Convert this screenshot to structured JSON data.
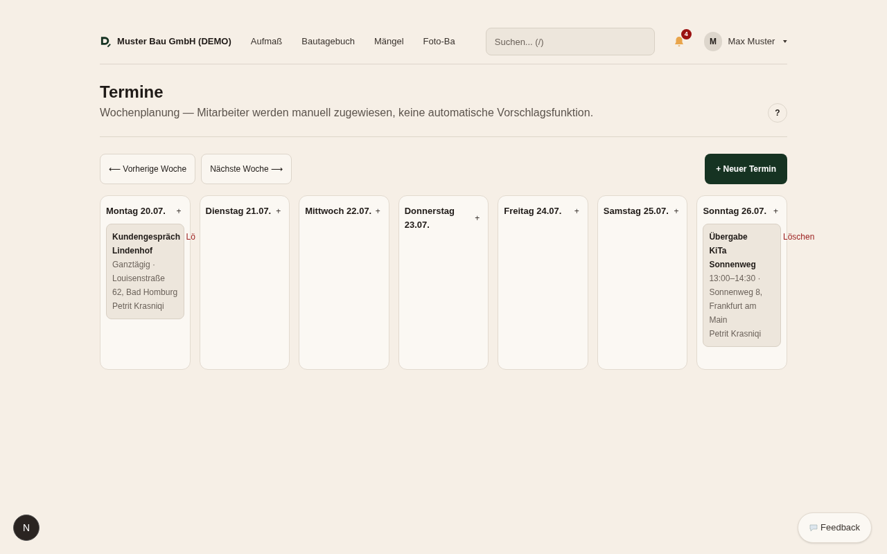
{
  "header": {
    "company": "Muster Bau GmbH (DEMO)",
    "nav": [
      "Aufmaß",
      "Bautagebuch",
      "Mängel",
      "Foto-Ba"
    ],
    "search": {
      "placeholder": "Suchen... (/)"
    },
    "notifications": "4",
    "user": {
      "initial": "M",
      "name": "Max Muster"
    }
  },
  "page": {
    "title": "Termine",
    "subtitle": "Wochenplanung — Mitarbeiter werden manuell zugewiesen, keine automatische Vorschlagsfunktion.",
    "help": "?"
  },
  "toolbar": {
    "prev": "⟵ Vorherige Woche",
    "next": "Nächste Woche ⟶",
    "new": "+ Neuer Termin"
  },
  "days": [
    {
      "label": "Montag 20.07.",
      "add": "+",
      "events": [
        {
          "title": "Kundengespräch Lindenhof",
          "details": "Ganztägig · Louisenstraße 62, Bad Homburg",
          "person": "Petrit Krasniqi",
          "delete": "Lö"
        }
      ]
    },
    {
      "label": "Dienstag 21.07.",
      "add": "+"
    },
    {
      "label": "Mittwoch 22.07.",
      "add": "+"
    },
    {
      "label": "Donnerstag 23.07.",
      "add": "+"
    },
    {
      "label": "Freitag 24.07.",
      "add": "+"
    },
    {
      "label": "Samstag 25.07.",
      "add": "+"
    },
    {
      "label": "Sonntag 26.07.",
      "add": "+",
      "events": [
        {
          "title": "Übergabe KiTa Sonnenweg",
          "details": "13:00–14:30 · Sonnenweg 8, Frankfurt am Main",
          "person": "Petrit Krasniqi",
          "delete": "Löschen"
        }
      ]
    }
  ],
  "dev_badge": "N",
  "feedback": "Feedback"
}
